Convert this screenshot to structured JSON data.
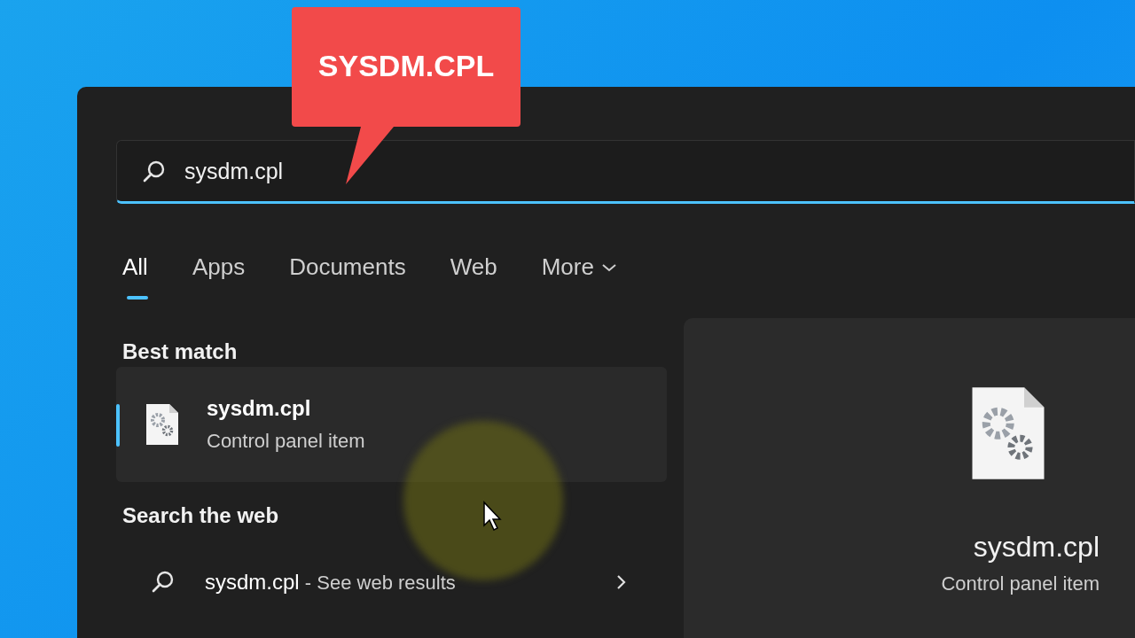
{
  "callout": {
    "text": "SYSDM.CPL"
  },
  "search": {
    "value": "sysdm.cpl"
  },
  "tabs": [
    {
      "label": "All",
      "kind": "tab",
      "selected": true
    },
    {
      "label": "Apps",
      "kind": "tab",
      "selected": false
    },
    {
      "label": "Documents",
      "kind": "tab",
      "selected": false
    },
    {
      "label": "Web",
      "kind": "tab",
      "selected": false
    },
    {
      "label": "More",
      "kind": "menu",
      "selected": false
    }
  ],
  "sections": [
    {
      "title": "Best match",
      "results": [
        {
          "kind": "app",
          "title": "sysdm.cpl",
          "subtitle": "Control panel item",
          "selected": true
        }
      ]
    },
    {
      "title": "Search the web",
      "results": [
        {
          "kind": "web",
          "title": "sysdm.cpl",
          "subtitle": "- See web results"
        }
      ]
    }
  ],
  "preview": {
    "title": "sysdm.cpl",
    "subtitle": "Control panel item"
  }
}
